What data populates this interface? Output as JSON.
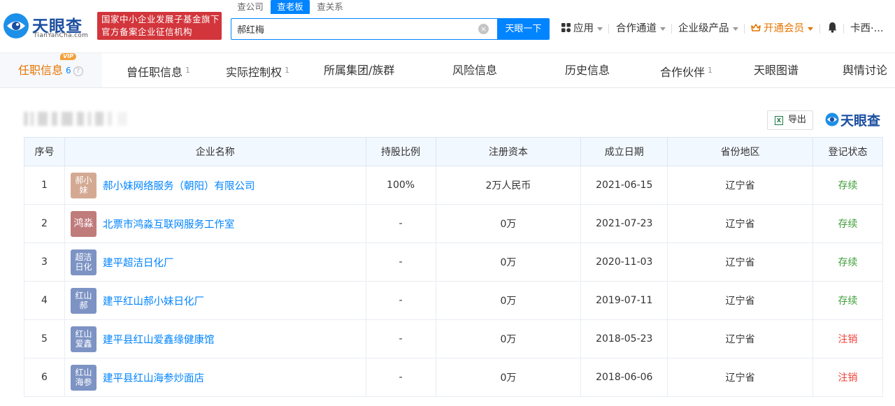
{
  "header": {
    "logo_text": "天眼查",
    "logo_sub": "TianYanCha.com",
    "gov_line1": "国家中小企业发展子基金旗下",
    "gov_line2": "官方备案企业征信机构",
    "search_tabs": [
      "查公司",
      "查老板",
      "查关系"
    ],
    "search_value": "郝红梅",
    "search_button": "天眼一下",
    "nav": {
      "apps": "应用",
      "channel": "合作通道",
      "enterprise": "企业级产品",
      "vip": "开通会员",
      "user": "卡西·..."
    },
    "colors": {
      "brand": "#1c4fa0",
      "accent": "#0084ff",
      "vip": "#e67400",
      "badge": "#d2353b"
    }
  },
  "tabs": [
    {
      "label": "任职信息",
      "count": "6",
      "vip": "VIP"
    },
    {
      "label": "曾任职信息",
      "count": "1"
    },
    {
      "label": "实际控制权",
      "count": "1"
    },
    {
      "label": "所属集团/族群",
      "count": ""
    },
    {
      "label": "风险信息",
      "count": ""
    },
    {
      "label": "历史信息",
      "count": ""
    },
    {
      "label": "合作伙伴",
      "count": "1"
    },
    {
      "label": "天眼图谱",
      "count": ""
    },
    {
      "label": "舆情讨论",
      "count": ""
    }
  ],
  "toolbar": {
    "export_label": "导出",
    "watermark": "天眼查",
    "excel_icon": "excel-icon"
  },
  "table": {
    "headers": [
      "序号",
      "企业名称",
      "持股比例",
      "注册资本",
      "成立日期",
      "省份地区",
      "登记状态"
    ],
    "rows": [
      {
        "no": "1",
        "logo": "郝小妹",
        "logo_color": "#d4a993",
        "name": "郝小妹网络服务（朝阳）有限公司",
        "share": "100%",
        "capital": "2万人民币",
        "date": "2021-06-15",
        "region": "辽宁省",
        "status": "存续"
      },
      {
        "no": "2",
        "logo": "鸿淼",
        "logo_color": "#c07b7b",
        "name": "北票市鸿淼互联网服务工作室",
        "share": "-",
        "capital": "0万",
        "date": "2021-07-23",
        "region": "辽宁省",
        "status": "存续"
      },
      {
        "no": "3",
        "logo": "超洁日化",
        "logo_color": "#7d93c4",
        "name": "建平超洁日化厂",
        "share": "-",
        "capital": "0万",
        "date": "2020-11-03",
        "region": "辽宁省",
        "status": "存续"
      },
      {
        "no": "4",
        "logo": "红山郝",
        "logo_color": "#7d93c4",
        "name": "建平红山郝小妹日化厂",
        "share": "-",
        "capital": "0万",
        "date": "2019-07-11",
        "region": "辽宁省",
        "status": "存续"
      },
      {
        "no": "5",
        "logo": "红山爱鑫",
        "logo_color": "#7d93c4",
        "name": "建平县红山爱鑫缘健康馆",
        "share": "-",
        "capital": "0万",
        "date": "2018-05-23",
        "region": "辽宁省",
        "status": "注销"
      },
      {
        "no": "6",
        "logo": "红山海参",
        "logo_color": "#7d93c4",
        "name": "建平县红山海参炒面店",
        "share": "-",
        "capital": "0万",
        "date": "2018-06-06",
        "region": "辽宁省",
        "status": "注销"
      }
    ]
  }
}
